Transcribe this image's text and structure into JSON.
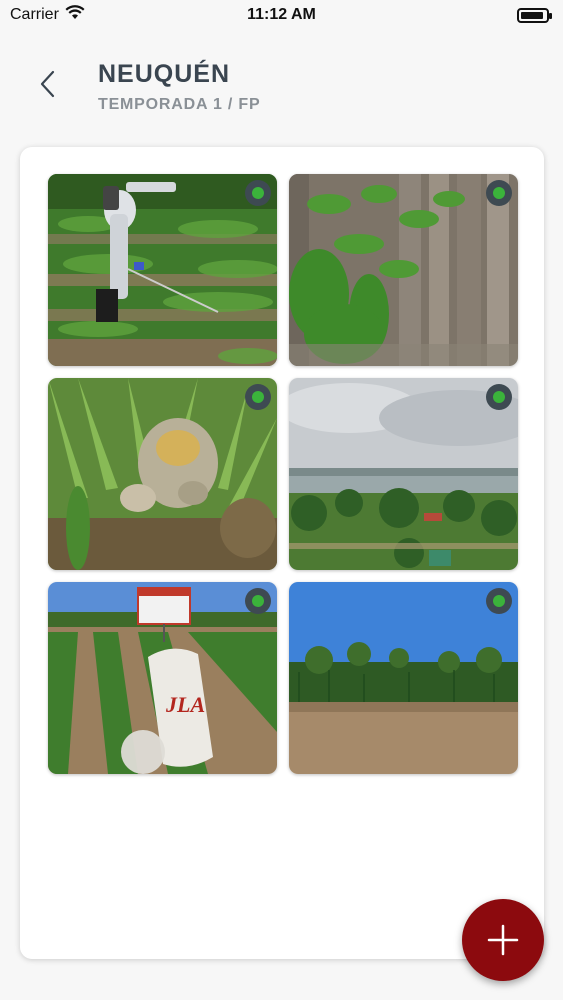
{
  "status_bar": {
    "carrier": "Carrier",
    "time": "11:12 AM",
    "icons": [
      "wifi-icon",
      "battery-icon"
    ]
  },
  "header": {
    "title": "NEUQUÉN",
    "subtitle": "TEMPORADA 1 / FP",
    "back_icon": "chevron-left-icon"
  },
  "gallery": {
    "photos": [
      {
        "name": "photo-worker-spraying-field",
        "status": "green"
      },
      {
        "name": "photo-plants-by-fence",
        "status": "green"
      },
      {
        "name": "photo-corn-ear-damage",
        "status": "green"
      },
      {
        "name": "photo-lake-landscape",
        "status": "green"
      },
      {
        "name": "photo-sample-bag-field",
        "status": "green"
      },
      {
        "name": "photo-cornfield-soil",
        "status": "green"
      }
    ],
    "sample_bag_brand": "JLA"
  },
  "fab": {
    "icon": "plus-icon"
  },
  "colors": {
    "accent": "#8c0a0e",
    "title": "#3a4550",
    "subtitle": "#8a9096",
    "status_dot": "#3bb33b"
  }
}
